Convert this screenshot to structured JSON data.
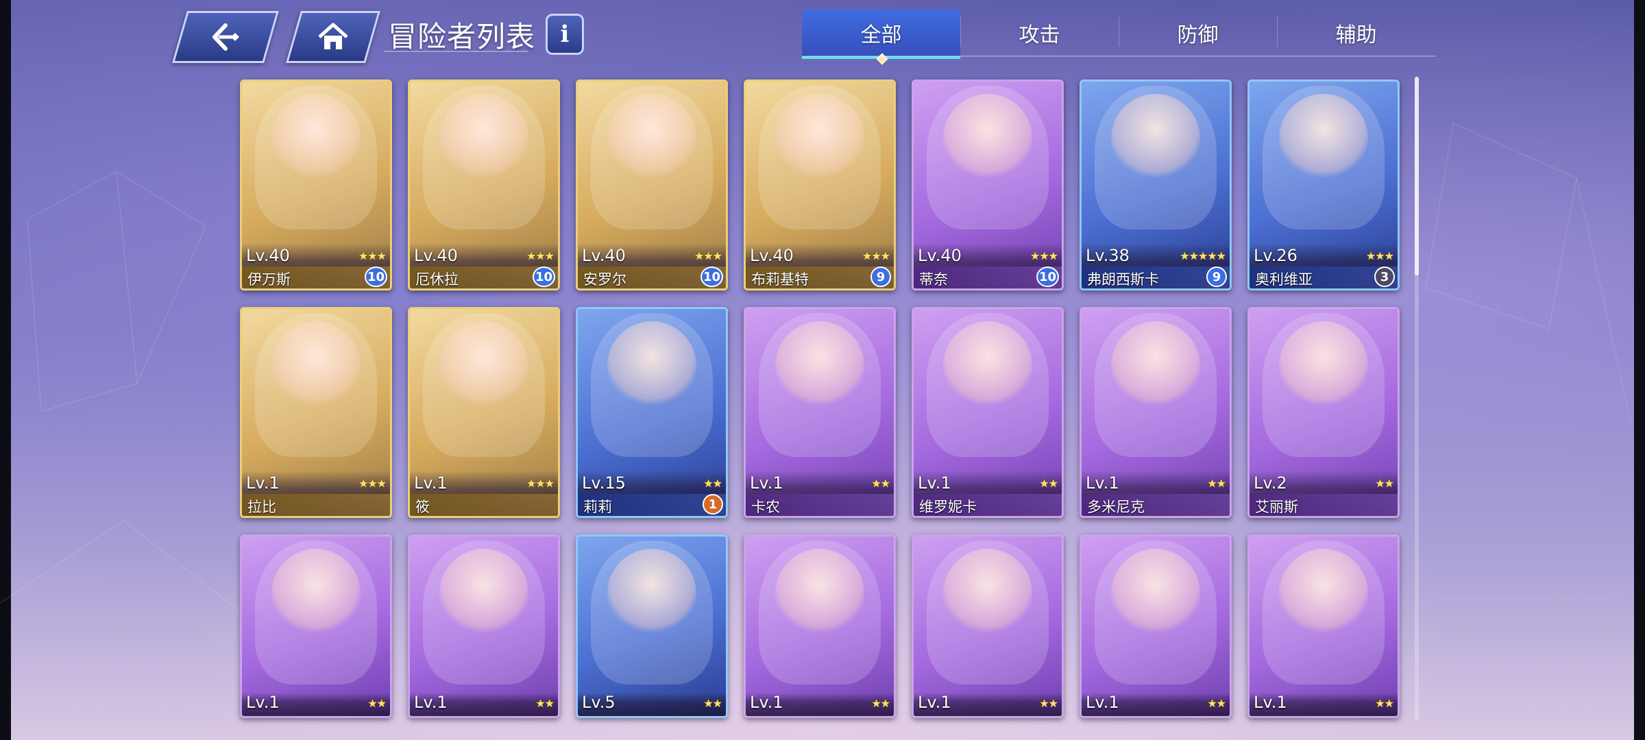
{
  "header": {
    "back_icon": "back-arrow-icon",
    "home_icon": "home-icon",
    "title": "冒险者列表",
    "info_icon": "info-icon",
    "info_label": "i"
  },
  "tabs": [
    {
      "label": "全部",
      "active": true
    },
    {
      "label": "攻击",
      "active": false
    },
    {
      "label": "防御",
      "active": false
    },
    {
      "label": "辅助",
      "active": false
    }
  ],
  "adventurers": [
    {
      "level": "Lv.40",
      "name": "伊万斯",
      "stars": "★★★",
      "rank": "10",
      "frame": "gold"
    },
    {
      "level": "Lv.40",
      "name": "厄休拉",
      "stars": "★★★",
      "rank": "10",
      "frame": "gold"
    },
    {
      "level": "Lv.40",
      "name": "安罗尔",
      "stars": "★★★",
      "rank": "10",
      "frame": "gold"
    },
    {
      "level": "Lv.40",
      "name": "布莉基特",
      "stars": "★★★",
      "rank": "9",
      "frame": "gold"
    },
    {
      "level": "Lv.40",
      "name": "蒂奈",
      "stars": "★★★",
      "rank": "10",
      "frame": "purple"
    },
    {
      "level": "Lv.38",
      "name": "弗朗西斯卡",
      "stars": "★★★★★",
      "rank": "9",
      "frame": "blue"
    },
    {
      "level": "Lv.26",
      "name": "奥利维亚",
      "stars": "★★★",
      "rank": "3",
      "frame": "blue"
    },
    {
      "level": "Lv.1",
      "name": "拉比",
      "stars": "★★★",
      "rank": "",
      "frame": "gold"
    },
    {
      "level": "Lv.1",
      "name": "筱",
      "stars": "★★★",
      "rank": "",
      "frame": "gold"
    },
    {
      "level": "Lv.15",
      "name": "莉莉",
      "stars": "★★",
      "rank": "1",
      "frame": "blue"
    },
    {
      "level": "Lv.1",
      "name": "卡农",
      "stars": "★★",
      "rank": "",
      "frame": "purple"
    },
    {
      "level": "Lv.1",
      "name": "维罗妮卡",
      "stars": "★★",
      "rank": "",
      "frame": "purple"
    },
    {
      "level": "Lv.1",
      "name": "多米尼克",
      "stars": "★★",
      "rank": "",
      "frame": "purple"
    },
    {
      "level": "Lv.2",
      "name": "艾丽斯",
      "stars": "★★",
      "rank": "",
      "frame": "purple"
    },
    {
      "level": "Lv.1",
      "name": "",
      "stars": "★★",
      "rank": "",
      "frame": "purple"
    },
    {
      "level": "Lv.1",
      "name": "",
      "stars": "★★",
      "rank": "",
      "frame": "purple"
    },
    {
      "level": "Lv.5",
      "name": "",
      "stars": "★★",
      "rank": "",
      "frame": "blue"
    },
    {
      "level": "Lv.1",
      "name": "",
      "stars": "★★",
      "rank": "",
      "frame": "purple"
    },
    {
      "level": "Lv.1",
      "name": "",
      "stars": "★★",
      "rank": "",
      "frame": "purple"
    },
    {
      "level": "Lv.1",
      "name": "",
      "stars": "★★",
      "rank": "",
      "frame": "purple"
    },
    {
      "level": "Lv.1",
      "name": "",
      "stars": "★★",
      "rank": "",
      "frame": "purple"
    }
  ],
  "colors": {
    "tab_active": "#3f72e6",
    "tab_underline": "#5ee3f4",
    "button_fill": "#3a4fa6",
    "star": "#ffe26a"
  }
}
